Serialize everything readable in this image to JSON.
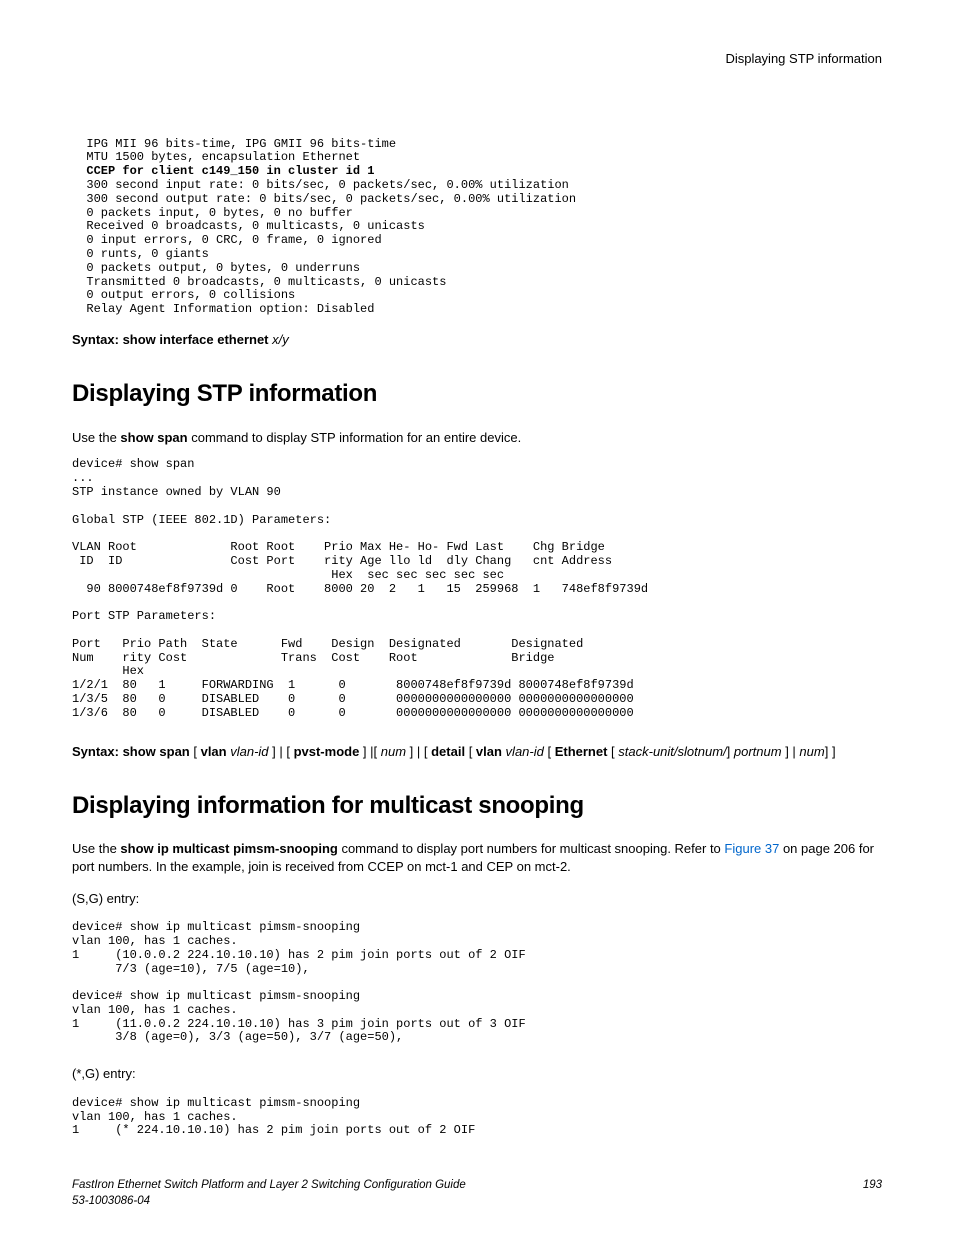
{
  "header": {
    "right": "Displaying STP information"
  },
  "code1": {
    "l1": "  IPG MII 96 bits-time, IPG GMII 96 bits-time",
    "l2": "  MTU 1500 bytes, encapsulation Ethernet",
    "l3": "  CCEP for client c149_150 in cluster id 1",
    "l4": "  300 second input rate: 0 bits/sec, 0 packets/sec, 0.00% utilization",
    "l5": "  300 second output rate: 0 bits/sec, 0 packets/sec, 0.00% utilization",
    "l6": "  0 packets input, 0 bytes, 0 no buffer",
    "l7": "  Received 0 broadcasts, 0 multicasts, 0 unicasts",
    "l8": "  0 input errors, 0 CRC, 0 frame, 0 ignored",
    "l9": "  0 runts, 0 giants",
    "l10": "  0 packets output, 0 bytes, 0 underruns",
    "l11": "  Transmitted 0 broadcasts, 0 multicasts, 0 unicasts",
    "l12": "  0 output errors, 0 collisions",
    "l13": "  Relay Agent Information option: Disabled"
  },
  "syntax1": {
    "prefix": "Syntax: show interface ethernet ",
    "ital": "x/y"
  },
  "section1": {
    "title": "Displaying STP information",
    "intro_a": "Use the ",
    "intro_b": "show span",
    "intro_c": " command to display STP information for an entire device."
  },
  "code2": {
    "text": "device# show span\n...\nSTP instance owned by VLAN 90\n\nGlobal STP (IEEE 802.1D) Parameters:\n\nVLAN Root             Root Root    Prio Max He- Ho- Fwd Last    Chg Bridge\n ID  ID               Cost Port    rity Age llo ld  dly Chang   cnt Address\n                                    Hex  sec sec sec sec sec\n  90 8000748ef8f9739d 0    Root    8000 20  2   1   15  259968  1   748ef8f9739d\n\nPort STP Parameters:\n\nPort   Prio Path  State      Fwd    Design  Designated       Designated\nNum    rity Cost             Trans  Cost    Root             Bridge\n       Hex\n1/2/1  80   1     FORWARDING  1      0       8000748ef8f9739d 8000748ef8f9739d\n1/3/5  80   0     DISABLED    0      0       0000000000000000 0000000000000000\n1/3/6  80   0     DISABLED    0      0       0000000000000000 0000000000000000"
  },
  "syntax2": {
    "p1": "Syntax: show span",
    "p2": " [ ",
    "p3": "vlan",
    "p4": " vlan-id ",
    "p5": "] | [ ",
    "p6": "pvst-mode",
    "p7": " ] |[ ",
    "p8": "num",
    "p9": " ] | [ ",
    "p10": "detail",
    "p11": " [ ",
    "p12": "vlan",
    "p13": " vlan-id ",
    "p14": "[ ",
    "p15": "Ethernet",
    "p16": " [ ",
    "p17": "stack-unit/slotnum/",
    "p18": "] ",
    "p19": "portnum",
    "p20": " ] | ",
    "p21": "num",
    "p22": "] ]"
  },
  "section2": {
    "title": "Displaying information for multicast snooping",
    "intro_a": "Use the ",
    "intro_b": "show ip multicast pimsm-snooping",
    "intro_c": " command to display port numbers for multicast snooping. Refer to ",
    "link": "Figure 37",
    "intro_d": " on page 206 for port numbers. In the example, join is received from CCEP on mct-1 and CEP on mct-2."
  },
  "sg1": "(S,G) entry:",
  "code3": {
    "text": "device# show ip multicast pimsm-snooping\nvlan 100, has 1 caches.\n1     (10.0.0.2 224.10.10.10) has 2 pim join ports out of 2 OIF\n      7/3 (age=10), 7/5 (age=10),\n\ndevice# show ip multicast pimsm-snooping\nvlan 100, has 1 caches.\n1     (11.0.0.2 224.10.10.10) has 3 pim join ports out of 3 OIF\n      3/8 (age=0), 3/3 (age=50), 3/7 (age=50),"
  },
  "sg2": "(*,G) entry:",
  "code4": {
    "text": "device# show ip multicast pimsm-snooping\nvlan 100, has 1 caches.\n1     (* 224.10.10.10) has 2 pim join ports out of 2 OIF"
  },
  "footer": {
    "left1": "FastIron Ethernet Switch Platform and Layer 2 Switching Configuration Guide",
    "left2": "53-1003086-04",
    "right": "193"
  }
}
